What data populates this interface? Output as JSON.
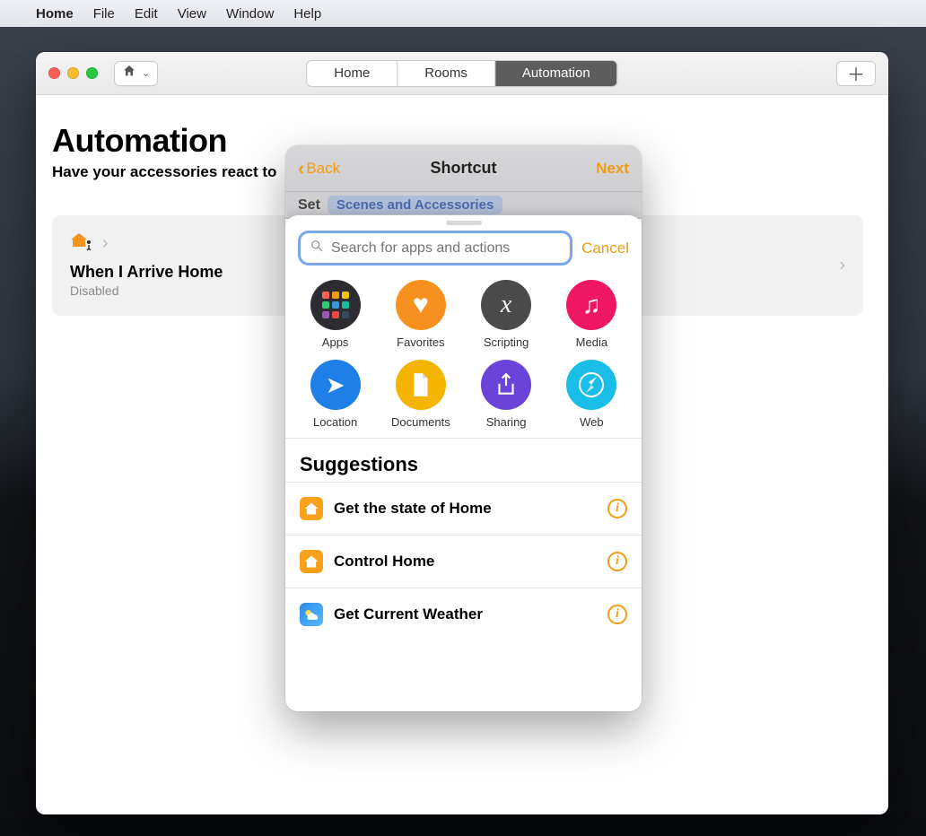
{
  "menubar": {
    "app": "Home",
    "items": [
      "File",
      "Edit",
      "View",
      "Window",
      "Help"
    ]
  },
  "tabs": {
    "home": "Home",
    "rooms": "Rooms",
    "automation": "Automation"
  },
  "page": {
    "title": "Automation",
    "subtitle": "Have your accessories react to"
  },
  "automation_card": {
    "title": "When I Arrive Home",
    "status": "Disabled"
  },
  "panel": {
    "back": "Back",
    "title": "Shortcut",
    "next": "Next",
    "set_label": "Set",
    "set_tag": "Scenes and Accessories"
  },
  "sheet": {
    "search_placeholder": "Search for apps and actions",
    "cancel": "Cancel",
    "categories": [
      {
        "key": "apps",
        "label": "Apps"
      },
      {
        "key": "favorites",
        "label": "Favorites"
      },
      {
        "key": "scripting",
        "label": "Scripting"
      },
      {
        "key": "media",
        "label": "Media"
      },
      {
        "key": "location",
        "label": "Location"
      },
      {
        "key": "documents",
        "label": "Documents"
      },
      {
        "key": "sharing",
        "label": "Sharing"
      },
      {
        "key": "web",
        "label": "Web"
      }
    ],
    "suggestions_title": "Suggestions",
    "suggestions": [
      {
        "icon": "home",
        "title": "Get the state of Home"
      },
      {
        "icon": "home",
        "title": "Control Home"
      },
      {
        "icon": "weather",
        "title": "Get Current Weather"
      }
    ]
  }
}
